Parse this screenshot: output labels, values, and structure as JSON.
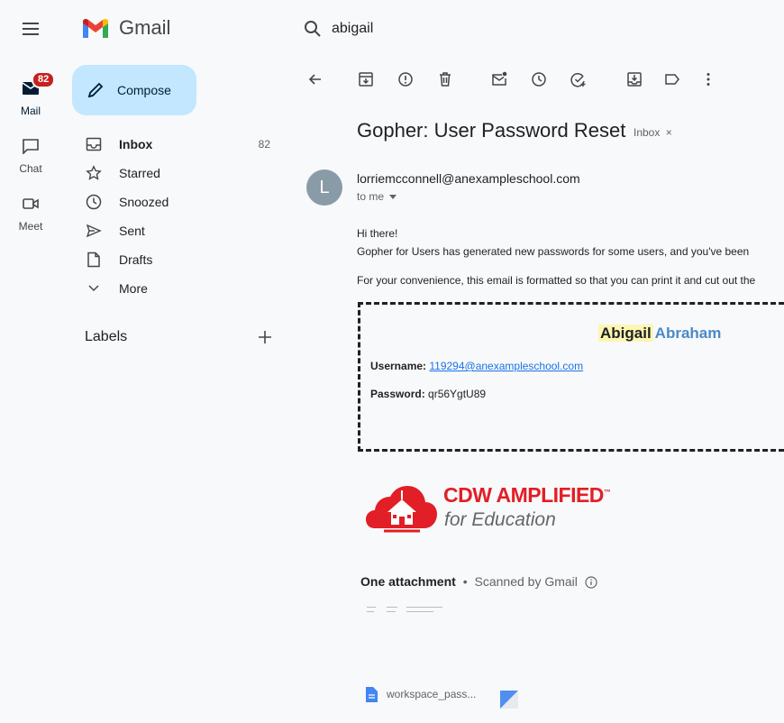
{
  "app": {
    "name": "Gmail"
  },
  "search": {
    "query": "abigail"
  },
  "rail": {
    "mail_label": "Mail",
    "mail_badge": "82",
    "chat_label": "Chat",
    "meet_label": "Meet"
  },
  "compose": {
    "label": "Compose"
  },
  "nav": {
    "items": [
      {
        "label": "Inbox",
        "count": "82",
        "icon": "inbox-icon"
      },
      {
        "label": "Starred",
        "icon": "star-icon"
      },
      {
        "label": "Snoozed",
        "icon": "clock-icon"
      },
      {
        "label": "Sent",
        "icon": "send-icon"
      },
      {
        "label": "Drafts",
        "icon": "draft-icon"
      },
      {
        "label": "More",
        "icon": "chevron-down-icon"
      }
    ],
    "labels_heading": "Labels"
  },
  "email": {
    "subject": "Gopher: User Password Reset",
    "label_chip": "Inbox",
    "chip_close": "×",
    "avatar_letter": "L",
    "sender": "lorriemcconnell@anexampleschool.com",
    "to": "to me",
    "greeting": "Hi there!",
    "line1": "Gopher for Users has generated new passwords for some users, and you've been",
    "line2": "For your convenience, this email is formatted so that you can print it and cut out the",
    "card": {
      "first_name": "Abigail",
      "last_name": "Abraham",
      "username_label": "Username:",
      "username": "119294@anexampleschool.com",
      "password_label": "Password:",
      "password": "qr56YgtU89"
    },
    "logo": {
      "title": "CDW AMPLIFIED",
      "tm": "™",
      "subtitle": "for Education"
    },
    "attachments": {
      "heading": "One attachment",
      "separator": "•",
      "scanned": "Scanned by Gmail",
      "file_name": "workspace_pass..."
    }
  },
  "colors": {
    "compose_bg": "#c2e7ff",
    "badge": "#c5221f",
    "link": "#1a73e8",
    "highlight": "#fdf6b2",
    "last_name": "#4a89c8",
    "logo_red": "#e21e26"
  }
}
